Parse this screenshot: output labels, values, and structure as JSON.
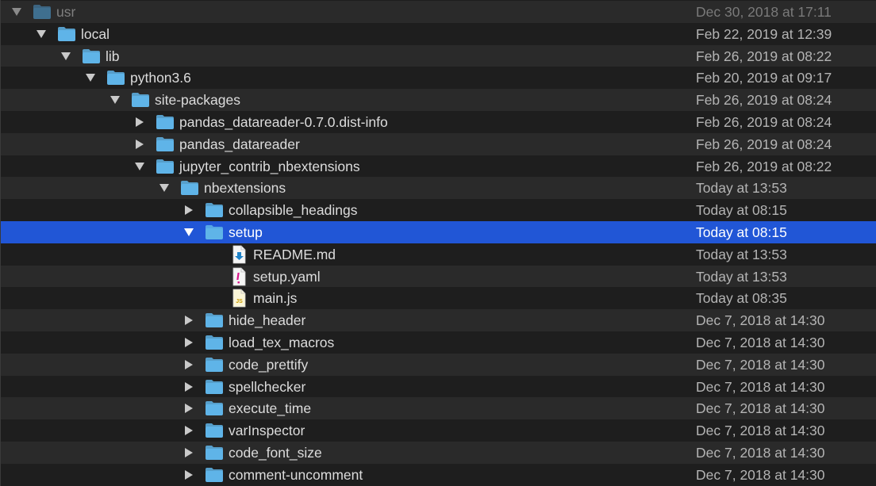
{
  "colors": {
    "background": "#1e1e1e",
    "row_alt": "#2a2a2a",
    "selection": "#2156d6",
    "folder": "#5fb4e8",
    "folder_dim": "#3f6f8f"
  },
  "rows": [
    {
      "name": "usr",
      "date": "Dec 30, 2018 at 17:11",
      "depth": 0,
      "kind": "folder",
      "disclosure": "expanded",
      "dim": true,
      "icon": "folder-icon"
    },
    {
      "name": "local",
      "date": "Feb 22, 2019 at 12:39",
      "depth": 1,
      "kind": "folder",
      "disclosure": "expanded",
      "icon": "folder-icon"
    },
    {
      "name": "lib",
      "date": "Feb 26, 2019 at 08:22",
      "depth": 2,
      "kind": "folder",
      "disclosure": "expanded",
      "icon": "folder-icon"
    },
    {
      "name": "python3.6",
      "date": "Feb 20, 2019 at 09:17",
      "depth": 3,
      "kind": "folder",
      "disclosure": "expanded",
      "icon": "folder-icon"
    },
    {
      "name": "site-packages",
      "date": "Feb 26, 2019 at 08:24",
      "depth": 4,
      "kind": "folder",
      "disclosure": "expanded",
      "icon": "folder-icon"
    },
    {
      "name": "pandas_datareader-0.7.0.dist-info",
      "date": "Feb 26, 2019 at 08:24",
      "depth": 5,
      "kind": "folder",
      "disclosure": "collapsed",
      "icon": "folder-icon"
    },
    {
      "name": "pandas_datareader",
      "date": "Feb 26, 2019 at 08:24",
      "depth": 5,
      "kind": "folder",
      "disclosure": "collapsed",
      "icon": "folder-icon"
    },
    {
      "name": "jupyter_contrib_nbextensions",
      "date": "Feb 26, 2019 at 08:22",
      "depth": 5,
      "kind": "folder",
      "disclosure": "expanded",
      "icon": "folder-icon"
    },
    {
      "name": "nbextensions",
      "date": "Today at 13:53",
      "depth": 6,
      "kind": "folder",
      "disclosure": "expanded",
      "icon": "folder-icon"
    },
    {
      "name": "collapsible_headings",
      "date": "Today at 08:15",
      "depth": 7,
      "kind": "folder",
      "disclosure": "collapsed",
      "icon": "folder-icon"
    },
    {
      "name": "setup",
      "date": "Today at 08:15",
      "depth": 7,
      "kind": "folder",
      "disclosure": "expanded",
      "selected": true,
      "icon": "folder-icon"
    },
    {
      "name": "README.md",
      "date": "Today at 13:53",
      "depth": 8,
      "kind": "markdown",
      "disclosure": "none",
      "icon": "markdown-file-icon"
    },
    {
      "name": "setup.yaml",
      "date": "Today at 13:53",
      "depth": 8,
      "kind": "yaml",
      "disclosure": "none",
      "icon": "yaml-file-icon"
    },
    {
      "name": "main.js",
      "date": "Today at 08:35",
      "depth": 8,
      "kind": "js",
      "disclosure": "none",
      "icon": "js-file-icon"
    },
    {
      "name": "hide_header",
      "date": "Dec 7, 2018 at 14:30",
      "depth": 7,
      "kind": "folder",
      "disclosure": "collapsed",
      "icon": "folder-icon"
    },
    {
      "name": "load_tex_macros",
      "date": "Dec 7, 2018 at 14:30",
      "depth": 7,
      "kind": "folder",
      "disclosure": "collapsed",
      "icon": "folder-icon"
    },
    {
      "name": "code_prettify",
      "date": "Dec 7, 2018 at 14:30",
      "depth": 7,
      "kind": "folder",
      "disclosure": "collapsed",
      "icon": "folder-icon"
    },
    {
      "name": "spellchecker",
      "date": "Dec 7, 2018 at 14:30",
      "depth": 7,
      "kind": "folder",
      "disclosure": "collapsed",
      "icon": "folder-icon"
    },
    {
      "name": "execute_time",
      "date": "Dec 7, 2018 at 14:30",
      "depth": 7,
      "kind": "folder",
      "disclosure": "collapsed",
      "icon": "folder-icon"
    },
    {
      "name": "varInspector",
      "date": "Dec 7, 2018 at 14:30",
      "depth": 7,
      "kind": "folder",
      "disclosure": "collapsed",
      "icon": "folder-icon"
    },
    {
      "name": "code_font_size",
      "date": "Dec 7, 2018 at 14:30",
      "depth": 7,
      "kind": "folder",
      "disclosure": "collapsed",
      "icon": "folder-icon"
    },
    {
      "name": "comment-uncomment",
      "date": "Dec 7, 2018 at 14:30",
      "depth": 7,
      "kind": "folder",
      "disclosure": "collapsed",
      "icon": "folder-icon"
    }
  ]
}
